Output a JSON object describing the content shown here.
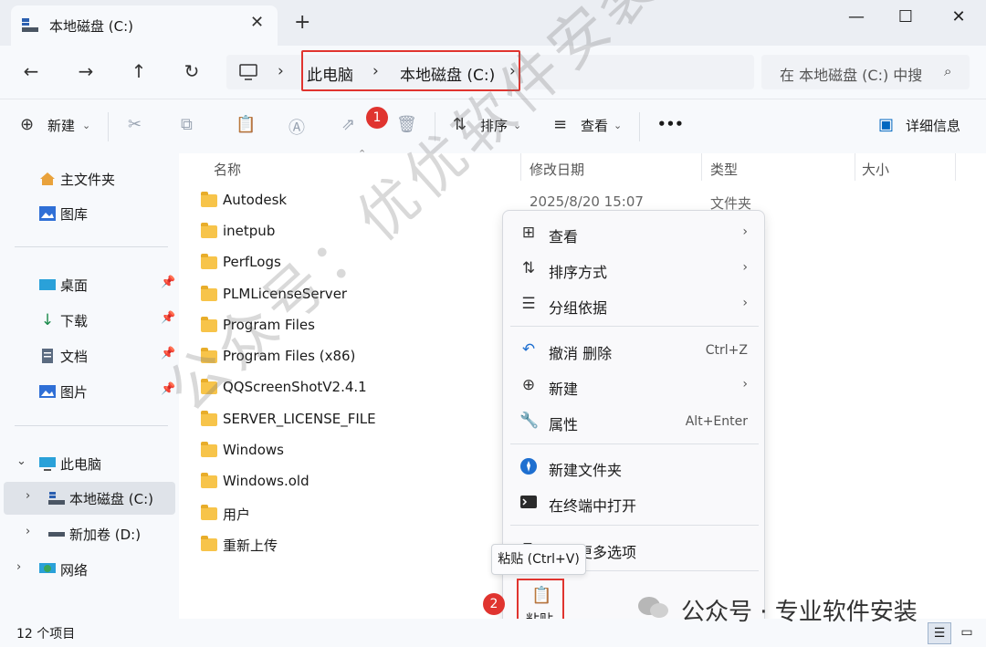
{
  "tab": {
    "label": "本地磁盘 (C:)",
    "close": "✕",
    "new_tab": "+"
  },
  "window": {
    "minimize": "—",
    "maximize": "☐",
    "close": "✕"
  },
  "nav": {
    "breadcrumb": [
      "此电脑",
      "本地磁盘 (C:)"
    ],
    "search_placeholder": "在 本地磁盘 (C:) 中搜"
  },
  "toolbar": {
    "new_label": "新建",
    "sort_label": "排序",
    "view_label": "查看",
    "more_label": "•••",
    "details_label": "详细信息",
    "badge1": "1"
  },
  "sidebar": {
    "quick": [
      {
        "label": "主文件夹",
        "icon": "home-icon"
      },
      {
        "label": "图库",
        "icon": "gallery-icon"
      }
    ],
    "pinned": [
      {
        "label": "桌面",
        "icon": "desktop-icon"
      },
      {
        "label": "下载",
        "icon": "download-icon"
      },
      {
        "label": "文档",
        "icon": "document-icon"
      },
      {
        "label": "图片",
        "icon": "picture-icon"
      }
    ],
    "tree": [
      {
        "label": "此电脑",
        "icon": "computer-icon",
        "expanded": true
      },
      {
        "label": "本地磁盘 (C:)",
        "icon": "drive-icon",
        "selected": true
      },
      {
        "label": "新加卷 (D:)",
        "icon": "drive-icon"
      },
      {
        "label": "网络",
        "icon": "network-icon"
      }
    ]
  },
  "columns": {
    "name": "名称",
    "modified": "修改日期",
    "type": "类型",
    "size": "大小"
  },
  "files": [
    {
      "name": "Autodesk",
      "modified": "2025/8/20 15:07",
      "type": "文件夹"
    },
    {
      "name": "inetpub"
    },
    {
      "name": "PerfLogs"
    },
    {
      "name": "PLMLicenseServer"
    },
    {
      "name": "Program Files"
    },
    {
      "name": "Program Files (x86)"
    },
    {
      "name": "QQScreenShotV2.4.1"
    },
    {
      "name": "SERVER_LICENSE_FILE"
    },
    {
      "name": "Windows"
    },
    {
      "name": "Windows.old"
    },
    {
      "name": "用户"
    },
    {
      "name": "重新上传"
    }
  ],
  "context_menu": {
    "items": [
      {
        "label": "查看",
        "icon": "grid-icon",
        "submenu": "›"
      },
      {
        "label": "排序方式",
        "icon": "sort-icon",
        "submenu": "›"
      },
      {
        "label": "分组依据",
        "icon": "group-icon",
        "submenu": "›"
      },
      {
        "label": "撤消 删除",
        "icon": "undo-icon",
        "shortcut": "Ctrl+Z"
      },
      {
        "label": "新建",
        "icon": "plus-circle-icon",
        "submenu": "›"
      },
      {
        "label": "属性",
        "icon": "wrench-icon",
        "shortcut": "Alt+Enter"
      },
      {
        "label": "新建文件夹",
        "icon": "new-folder-icon"
      },
      {
        "label": "在终端中打开",
        "icon": "terminal-icon"
      },
      {
        "label": "显示更多选项",
        "icon": "more-options-icon"
      }
    ],
    "tooltip": "粘贴 (Ctrl+V)",
    "paste_label": "粘贴",
    "badge2": "2"
  },
  "status": {
    "count": "12 个项目"
  },
  "watermark": {
    "text": "公众号：优优软件安装",
    "footer": "公众号 · 专业软件安装"
  },
  "colors": {
    "accent": "#0067c0",
    "highlight": "#e0342f",
    "folder": "#f7c44a"
  }
}
